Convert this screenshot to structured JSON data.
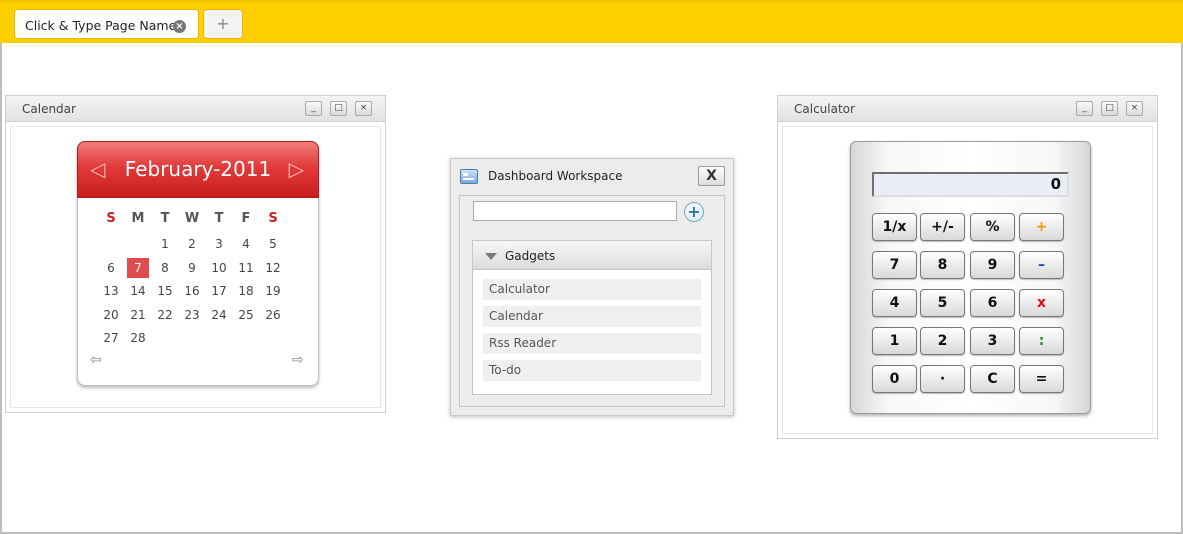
{
  "tabbar": {
    "active_tab": "Click & Type Page Name",
    "close_glyph": "×",
    "add_glyph": "+"
  },
  "calendar_widget": {
    "title": "Calendar",
    "minimize_glyph": "_",
    "maximize_glyph": "□",
    "close_glyph": "×",
    "month": "February-2011",
    "prev_glyph": "◁",
    "next_glyph": "▷",
    "weekdays": [
      "S",
      "M",
      "T",
      "W",
      "T",
      "F",
      "S"
    ],
    "days": [
      [
        "",
        "",
        "1",
        "2",
        "3",
        "4",
        "5"
      ],
      [
        "6",
        "7",
        "8",
        "9",
        "10",
        "11",
        "12"
      ],
      [
        "13",
        "14",
        "15",
        "16",
        "17",
        "18",
        "19"
      ],
      [
        "20",
        "21",
        "22",
        "23",
        "24",
        "25",
        "26"
      ],
      [
        "27",
        "28",
        "",
        "",
        "",
        "",
        ""
      ]
    ],
    "today": "7",
    "back_glyph": "⇦",
    "forward_glyph": "⇨"
  },
  "dashboard": {
    "title": "Dashboard Workspace",
    "close_glyph": "X",
    "search_value": "",
    "add_glyph": "+",
    "gadgets_label": "Gadgets",
    "gadgets": [
      "Calculator",
      "Calendar",
      "Rss Reader",
      "To-do"
    ]
  },
  "calculator_widget": {
    "title": "Calculator",
    "minimize_glyph": "_",
    "maximize_glyph": "□",
    "close_glyph": "×",
    "display": "0",
    "keys": [
      [
        "1/x",
        "+/-",
        "%",
        "+"
      ],
      [
        "7",
        "8",
        "9",
        "–"
      ],
      [
        "4",
        "5",
        "6",
        "x"
      ],
      [
        "1",
        "2",
        "3",
        ":"
      ],
      [
        "0",
        "·",
        "C",
        "="
      ]
    ]
  },
  "colors": {
    "topbar": "#ffcf00",
    "calendar_header": "#e23a3a",
    "today_highlight": "#e04b4b"
  }
}
